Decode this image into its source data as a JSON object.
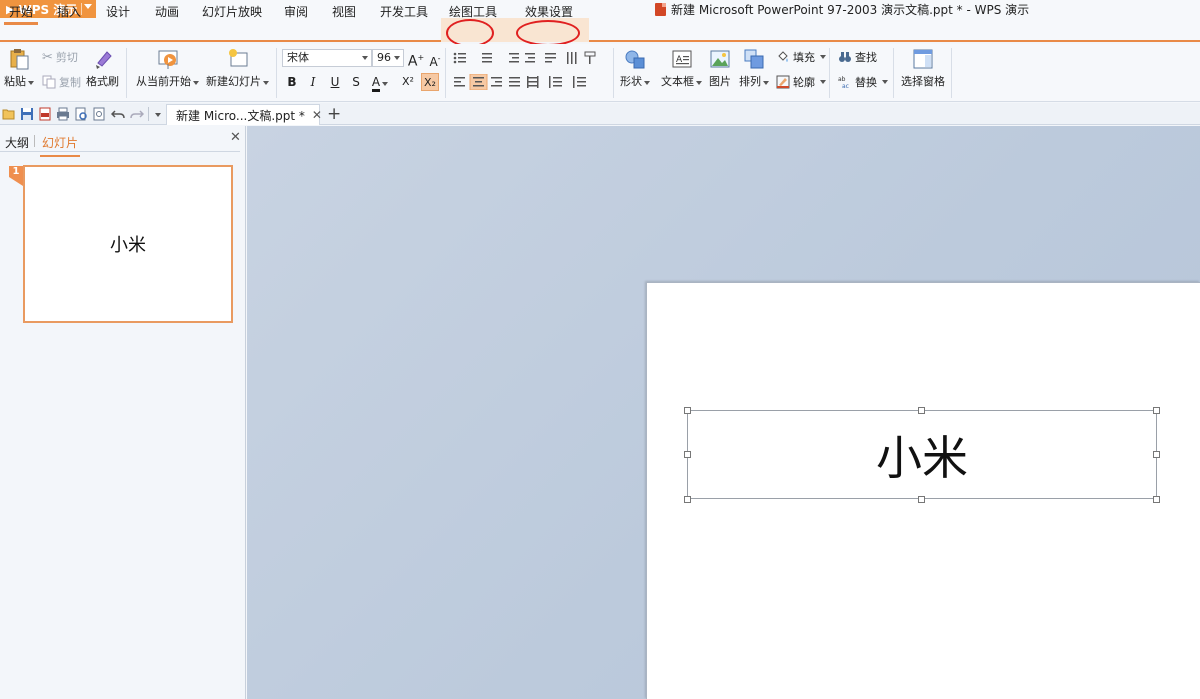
{
  "titlebar": {
    "app_name": "WPS 演示",
    "window_title": "新建 Microsoft PowerPoint 97-2003 演示文稿.ppt * - WPS 演示"
  },
  "menu": {
    "tabs": [
      {
        "label": "开始",
        "active": true
      },
      {
        "label": "插入"
      },
      {
        "label": "设计"
      },
      {
        "label": "动画"
      },
      {
        "label": "幻灯片放映"
      },
      {
        "label": "审阅"
      },
      {
        "label": "视图"
      },
      {
        "label": "开发工具"
      },
      {
        "label": "绘图工具",
        "contextual": true,
        "circled": true
      },
      {
        "label": "效果设置",
        "contextual": true,
        "circled": true
      }
    ]
  },
  "ribbon": {
    "paste": "粘贴",
    "cut": "剪切",
    "copy": "复制",
    "format_painter": "格式刷",
    "play_from_current": "从当前开始",
    "new_slide": "新建幻灯片",
    "font_name": "宋体",
    "font_size": "96",
    "grow_font": "A",
    "shrink_font": "A",
    "bold": "B",
    "italic": "I",
    "underline": "U",
    "shadow": "S",
    "font_color": "A",
    "superscript": "X²",
    "subscript": "X₂",
    "shapes": "形状",
    "textbox": "文本框",
    "picture": "图片",
    "arrange": "排列",
    "fill": "填充",
    "outline": "轮廓",
    "find": "查找",
    "replace": "替换",
    "selection_pane": "选择窗格"
  },
  "quickbar": {
    "doc_tab_label": "新建 Micro...文稿.ppt *",
    "close_symbol": "✕",
    "new_tab_symbol": "+"
  },
  "left_panel": {
    "tabs": [
      "大纲",
      "幻灯片"
    ],
    "active_tab": "幻灯片",
    "close_symbol": "✕",
    "slides": [
      {
        "number": "1",
        "text": "小米"
      }
    ]
  },
  "slide": {
    "text": "小米"
  },
  "colors": {
    "accent": "#e98a47",
    "app_button": "#f0943f",
    "annotation": "#e02020"
  }
}
